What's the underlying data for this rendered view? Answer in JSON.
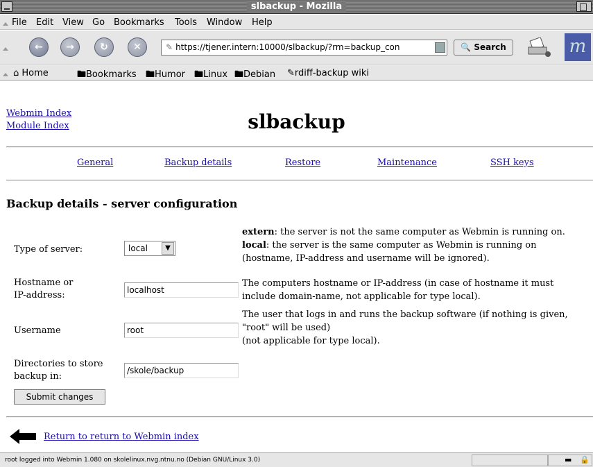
{
  "window": {
    "title": "slbackup - Mozilla"
  },
  "menu": [
    "File",
    "Edit",
    "View",
    "Go",
    "Bookmarks",
    "Tools",
    "Window",
    "Help"
  ],
  "toolbar": {
    "back_icon": "back-arrow-icon",
    "url": "https://tjener.intern:10000/slbackup/?rm=backup_con",
    "search_label": "Search"
  },
  "bookmarks": [
    "Home",
    "Bookmarks",
    "Humor",
    "Linux",
    "Debian",
    "rdiff-backup wiki"
  ],
  "page": {
    "webmin_index": "Webmin Index",
    "module_index": "Module Index",
    "title": "slbackup",
    "tabs": [
      "General",
      "Backup details",
      "Restore",
      "Maintenance",
      "SSH keys"
    ],
    "section_title": "Backup details - server configuration",
    "server_type_label": "Type of server:",
    "server_type_value": "local",
    "server_help_extern_key": "extern",
    "server_help_extern": ": the server is not the same computer as Webmin is running on.",
    "server_help_local_key": "local",
    "server_help_local": ": the server is the same computer as Webmin is running on",
    "server_help_local2": "(hostname, IP-address and username will be ignored).",
    "hostname_label_1": "Hostname or",
    "hostname_label_2": "IP-address:",
    "hostname_value": "localhost",
    "hostname_help_1": "The computers hostname or IP-address (in case of hostname it must",
    "hostname_help_2": "include domain-name, not applicable for type local).",
    "username_label": "Username",
    "username_value": "root",
    "username_help_1": "The user that logs in and runs the backup software (if nothing is given,",
    "username_help_2": "\"root\" will be used)",
    "username_help_3": "(not applicable for type local).",
    "dirs_label_1": "Directories to store",
    "dirs_label_2": "backup in:",
    "dirs_value": "/skole/backup",
    "submit_label": "Submit changes",
    "return_link": "Return to return to Webmin index"
  },
  "status": {
    "text": "root logged into Webmin 1.080 on skolelinux.nvg.ntnu.no (Debian GNU/Linux 3.0)"
  }
}
